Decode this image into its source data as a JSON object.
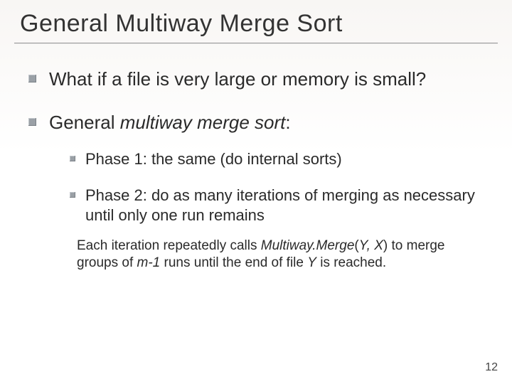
{
  "title": "General Multiway Merge Sort",
  "bullets": [
    {
      "text": "What if a file is very large or memory is small?"
    },
    {
      "prefix": "General ",
      "ital": "multiway merge sort",
      "suffix": ":",
      "sub": [
        {
          "text": "Phase 1: the same (do internal sorts)"
        },
        {
          "text": "Phase 2: do as many iterations of merging as necessary until only one run remains"
        }
      ],
      "note": {
        "p1": "Each iteration repeatedly calls ",
        "i1": "Multiway.Merge",
        "p2": "(",
        "i2": "Y, X",
        "p3": ") to merge groups of ",
        "i3": "m-1",
        "p4": " runs until the end of file ",
        "i4": "Y",
        "p5": " is reached."
      }
    }
  ],
  "page": "12"
}
